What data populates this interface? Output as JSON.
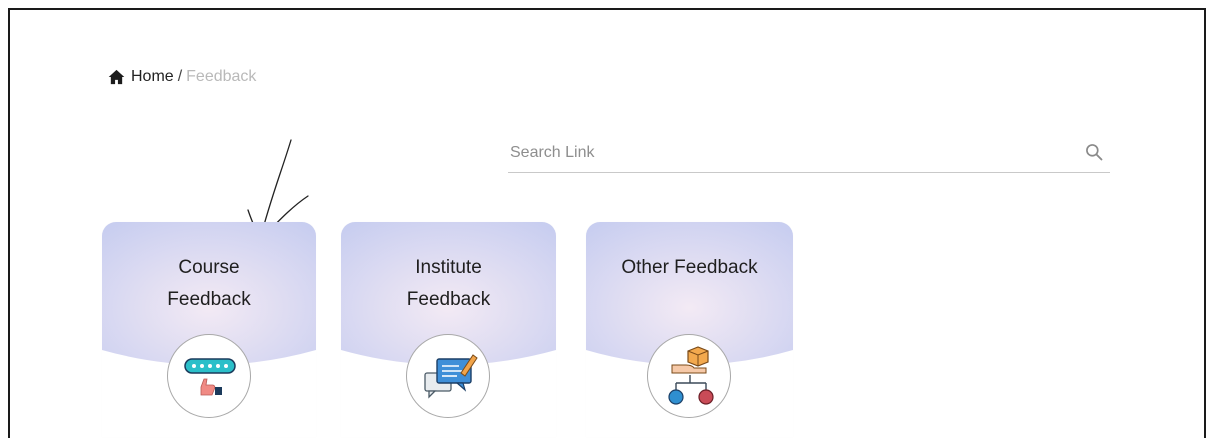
{
  "breadcrumb": {
    "home_label": "Home",
    "separator": "/",
    "current": "Feedback"
  },
  "search": {
    "placeholder": "Search Link"
  },
  "cards": [
    {
      "title_line1": "Course",
      "title_line2": "Feedback",
      "icon": "rating-thumbs-up-icon"
    },
    {
      "title_line1": "Institute",
      "title_line2": "Feedback",
      "icon": "chat-feedback-icon"
    },
    {
      "title_line1": "Other Feedback",
      "title_line2": "",
      "icon": "workflow-box-icon"
    }
  ],
  "colors": {
    "card_header_top": "#c9cff0",
    "card_header_center": "#f1e8f3",
    "breadcrumb_current": "#b9b9b9",
    "text": "#1f1f1f"
  }
}
